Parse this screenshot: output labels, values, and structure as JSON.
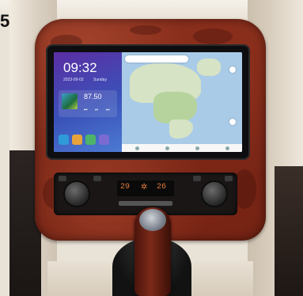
{
  "corner_label": "5",
  "screen": {
    "clock": "09:32",
    "date": "2023-09-03",
    "weekday": "Sunday",
    "radio_frequency": "87.50",
    "radio_controls": [
      "⏮",
      "⏯",
      "⏭"
    ]
  },
  "climate": {
    "left_temp": "29",
    "right_temp": "26",
    "fan_icon": "fan-icon"
  },
  "colors": {
    "wood": "#7a2515",
    "screen_sidebar": "#3a52b9",
    "climate_display": "#e07a3a"
  }
}
